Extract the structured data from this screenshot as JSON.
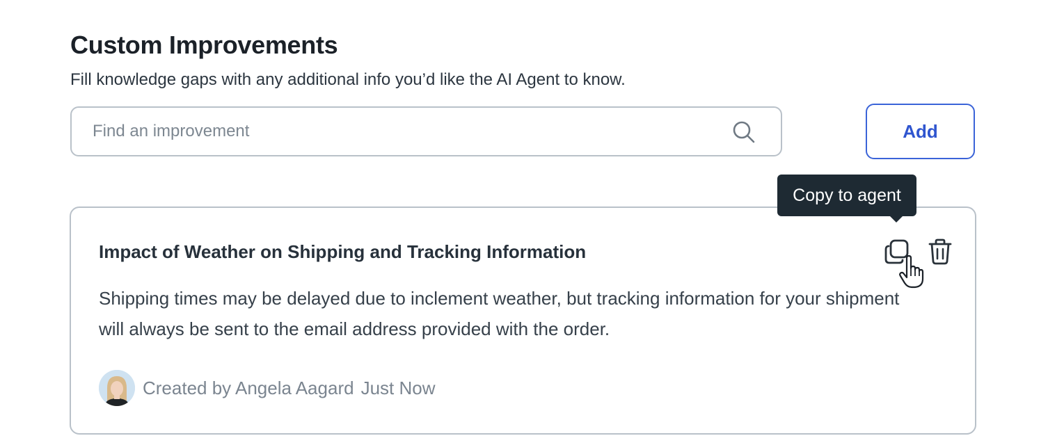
{
  "section": {
    "title": "Custom Improvements",
    "subtitle": "Fill knowledge gaps with any additional info you’d like the AI Agent to know."
  },
  "search": {
    "placeholder": "Find an improvement",
    "value": ""
  },
  "add_button": {
    "label": "Add"
  },
  "tooltip": {
    "text": "Copy to agent"
  },
  "improvement": {
    "title": "Impact of Weather on Shipping and Tracking Information",
    "body": "Shipping times may be delayed due to inclement weather, but tracking information for your shipment will always be sent to the email address provided with the order.",
    "created_by": "Created by Angela Aagard",
    "timestamp": "Just Now"
  },
  "icons": {
    "search": "search-icon",
    "copy": "copy-icon",
    "delete": "trash-icon",
    "cursor": "hand-pointer-icon"
  },
  "colors": {
    "accent": "#2f55cf",
    "border": "#b9c1c9",
    "tooltip_bg": "#1e2a33",
    "muted_text": "#7b8590"
  }
}
